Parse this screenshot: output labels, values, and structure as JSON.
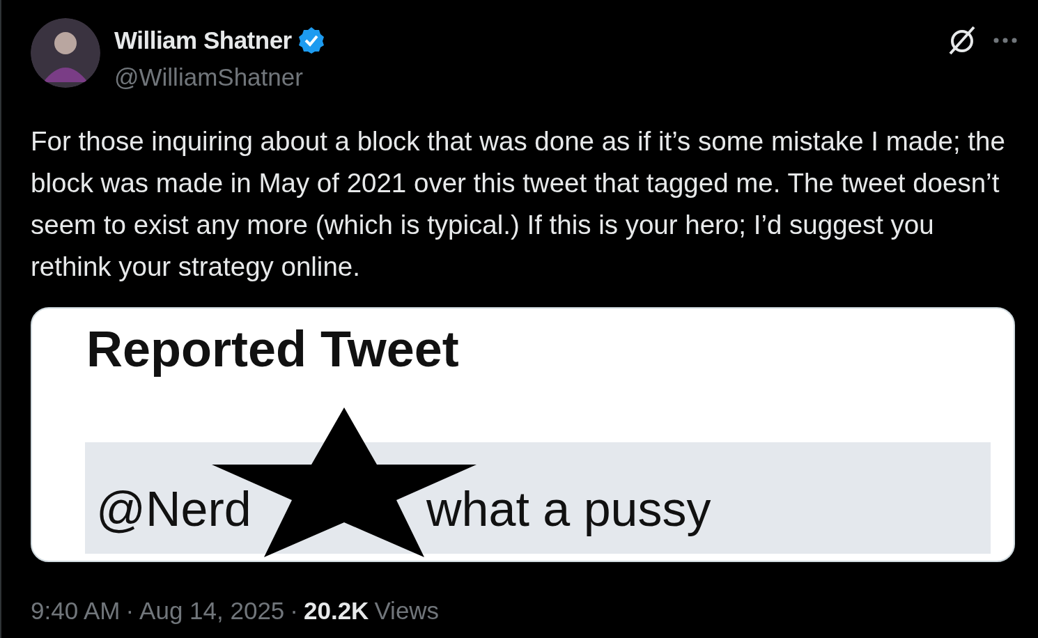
{
  "author": {
    "name": "William Shatner",
    "verified": true,
    "handle": "@WilliamShatner"
  },
  "text": "For those inquiring about a block that was done as if it’s some mistake I made; the block was made in May of 2021 over this tweet that tagged me.  The tweet doesn’t seem to exist any more (which is typical.) If this is your hero; I’d suggest you rethink your strategy online.",
  "image": {
    "heading": "Reported Tweet",
    "mention": "@Nerd",
    "reply_text": "what a pussy"
  },
  "footer": {
    "time": "9:40 AM",
    "separators": [
      "·",
      "·"
    ],
    "date": "Aug 14, 2025",
    "views_count": "20.2K",
    "views_label": "Views"
  }
}
